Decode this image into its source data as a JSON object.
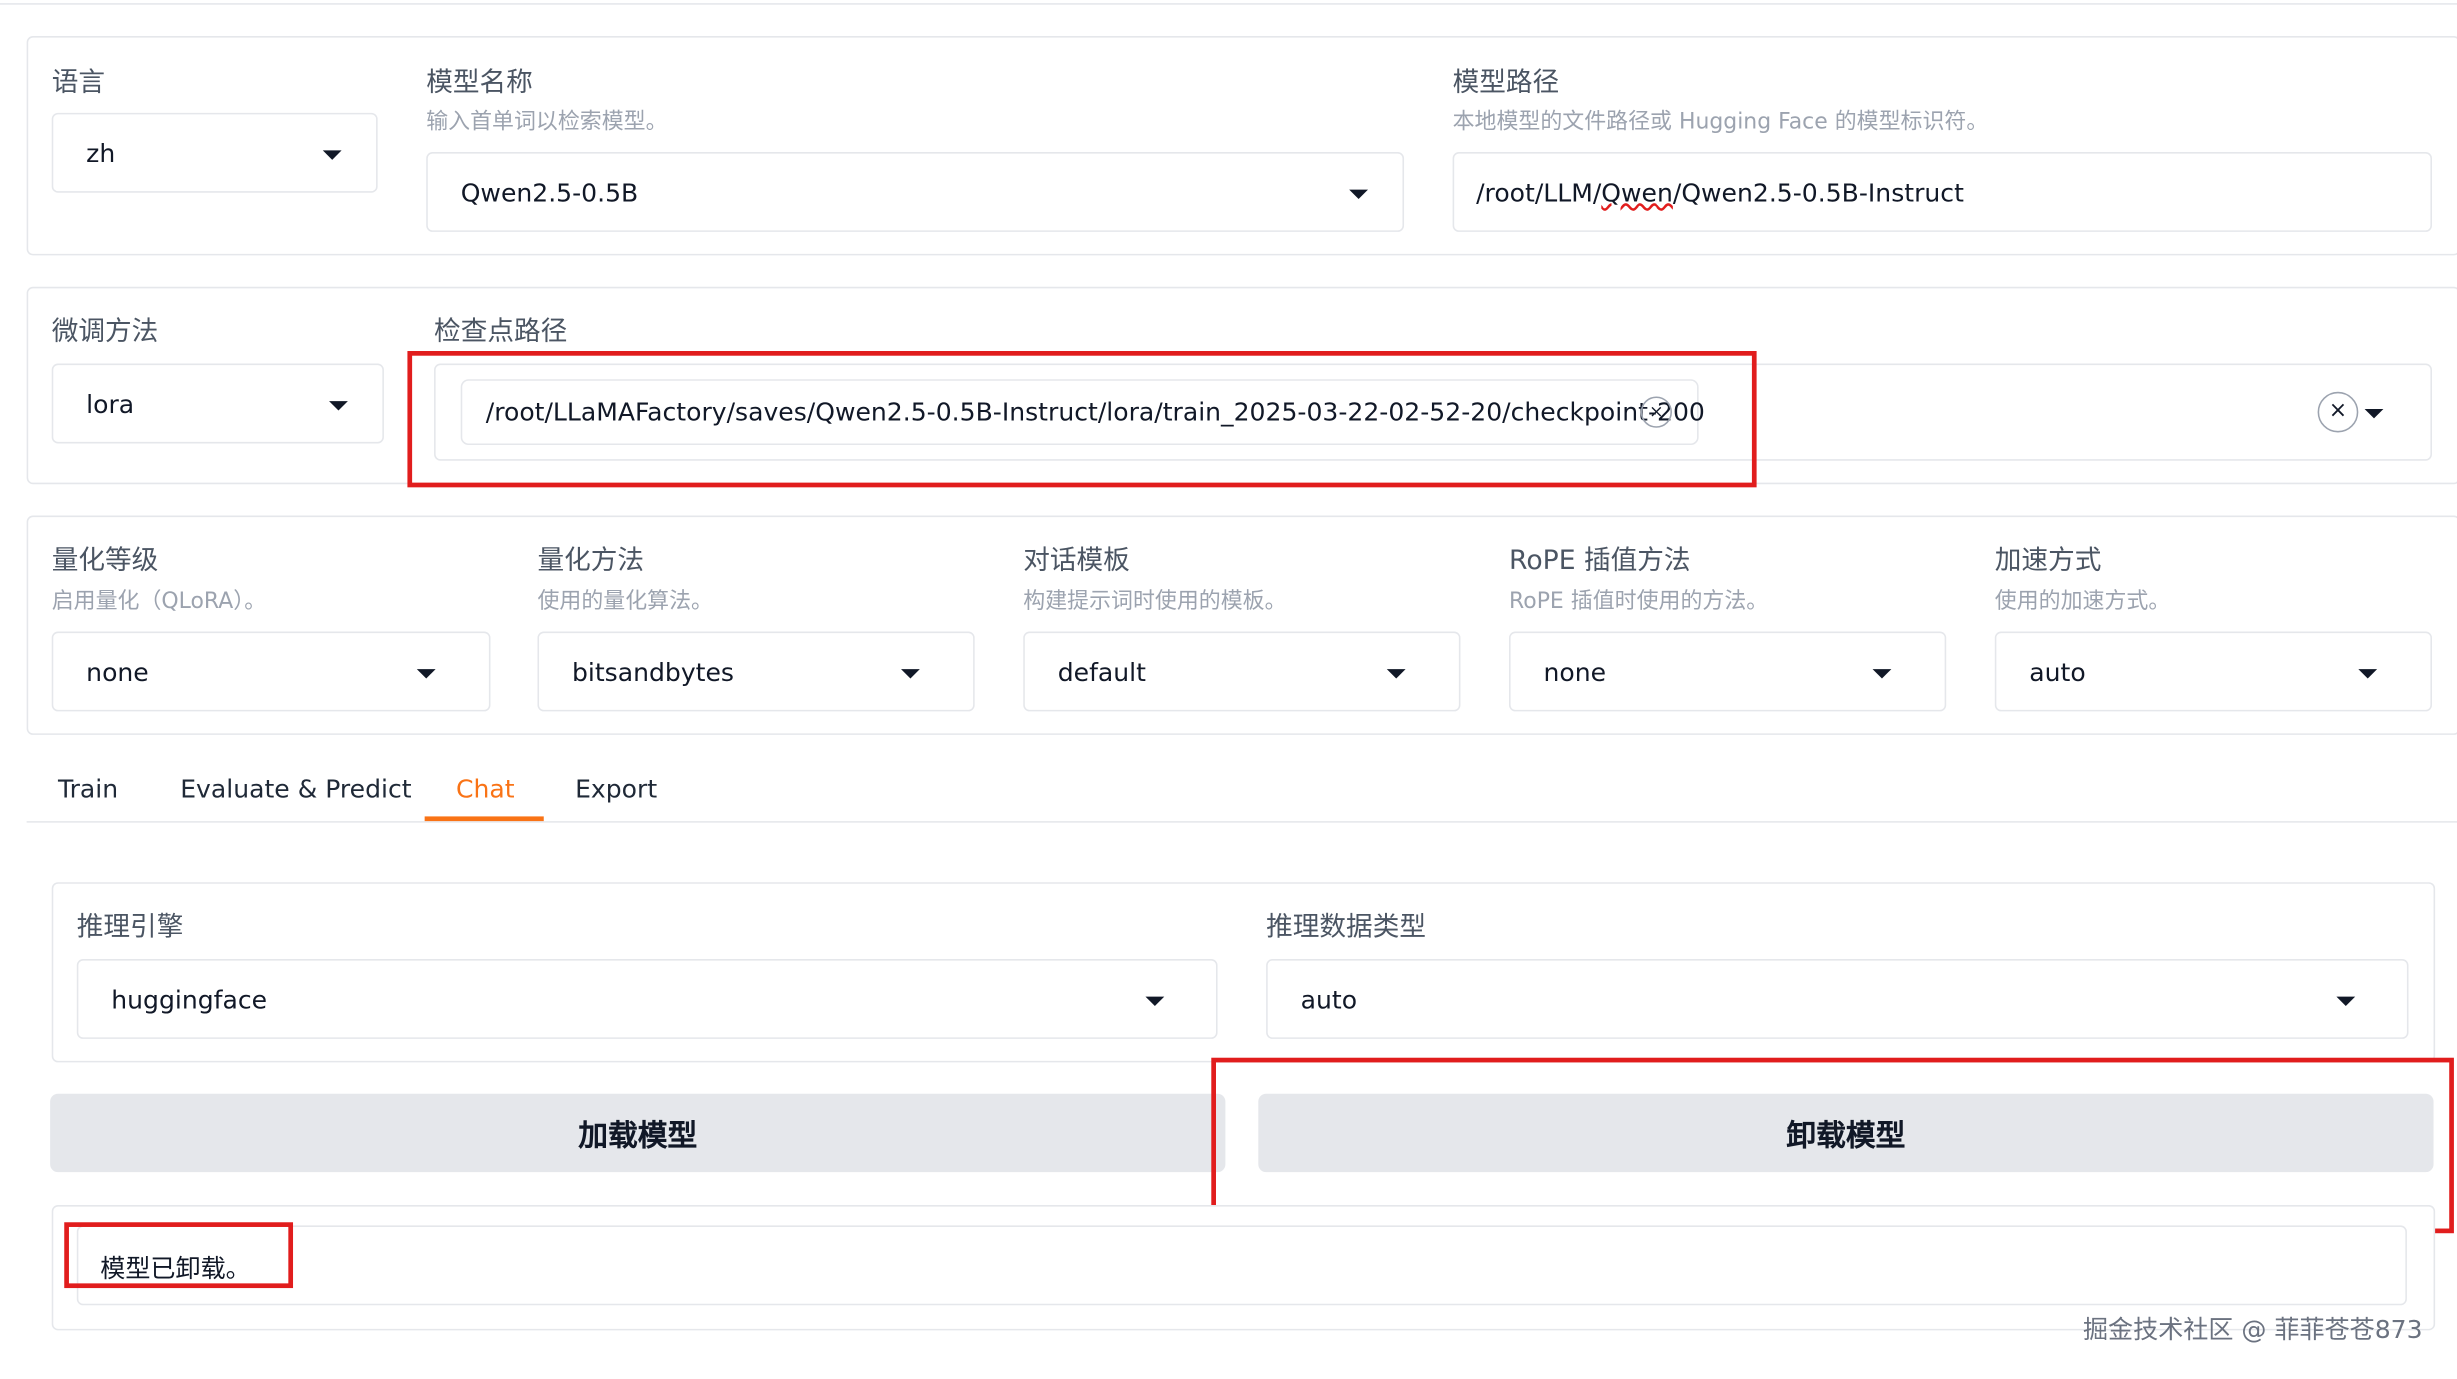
{
  "top": {
    "language": {
      "label": "语言",
      "value": "zh"
    },
    "model_name": {
      "label": "模型名称",
      "hint": "输入首单词以检索模型。",
      "value": "Qwen2.5-0.5B"
    },
    "model_path": {
      "label": "模型路径",
      "hint": "本地模型的文件路径或 Hugging Face 的模型标识符。",
      "value_prefix": "/root/LLM/",
      "value_squiggle": "Qwen",
      "value_suffix": "/Qwen2.5-0.5B-Instruct"
    }
  },
  "finetune": {
    "method": {
      "label": "微调方法",
      "value": "lora"
    },
    "checkpoint": {
      "label": "检查点路径",
      "chip": "/root/LLaMAFactory/saves/Qwen2.5-0.5B-Instruct/lora/train_2025-03-22-02-52-20/checkpoint-200",
      "chip_remove": "×",
      "clear": "×"
    }
  },
  "advanced": {
    "quant_bit": {
      "label": "量化等级",
      "hint": "启用量化（QLoRA）。",
      "value": "none"
    },
    "quant_method": {
      "label": "量化方法",
      "hint": "使用的量化算法。",
      "value": "bitsandbytes"
    },
    "template": {
      "label": "对话模板",
      "hint": "构建提示词时使用的模板。",
      "value": "default"
    },
    "rope": {
      "label": "RoPE 插值方法",
      "hint": "RoPE 插值时使用的方法。",
      "value": "none"
    },
    "booster": {
      "label": "加速方式",
      "hint": "使用的加速方式。",
      "value": "auto"
    }
  },
  "tabs": [
    "Train",
    "Evaluate & Predict",
    "Chat",
    "Export"
  ],
  "active_tab": "Chat",
  "chat": {
    "infer_backend": {
      "label": "推理引擎",
      "value": "huggingface"
    },
    "infer_dtype": {
      "label": "推理数据类型",
      "value": "auto"
    },
    "load_button": "加载模型",
    "unload_button": "卸载模型",
    "info_box": "模型已卸载。"
  },
  "watermark": "掘金技术社区 @ 菲菲苍苍873",
  "colors": {
    "accent": "#f97316",
    "highlight": "#e11d1d",
    "button_bg": "#e5e7eb"
  }
}
